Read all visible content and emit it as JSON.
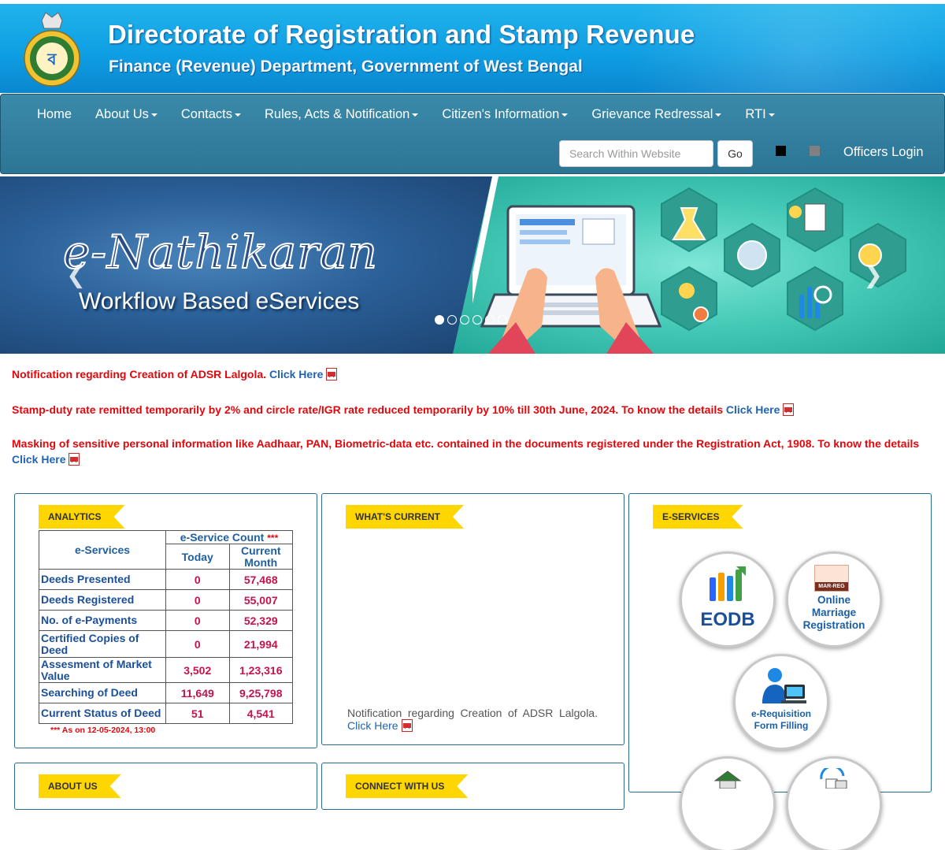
{
  "header": {
    "title": "Directorate of Registration and Stamp Revenue",
    "subtitle": "Finance (Revenue) Department, Government of West Bengal"
  },
  "nav": {
    "items": [
      "Home",
      "About Us",
      "Contacts",
      "Rules, Acts & Notification",
      "Citizen's Information",
      "Grievance Redressal",
      "RTI"
    ],
    "search_placeholder": "Search Within Website",
    "go_label": "Go",
    "officers_login": "Officers Login"
  },
  "banner": {
    "title": "e-Nathikaran",
    "subtitle": "Workflow Based eServices",
    "slide_count": 6,
    "active_slide": 1
  },
  "notices": [
    {
      "text": "Notification regarding Creation of ADSR Lalgola.",
      "link": "Click Here"
    },
    {
      "text": "Stamp-duty rate remitted temporarily by 2% and circle rate/IGR rate reduced temporarily by 10% till 30th June, 2024. To know the details",
      "link": "Click Here"
    },
    {
      "text": "Masking of sensitive personal information like Aadhaar, PAN, Biometric-data etc. contained in the documents registered under the Registration Act, 1908. To know the details",
      "link": "Click Here"
    }
  ],
  "analytics": {
    "ribbon": "ANALYTICS",
    "col_service": "e-Services",
    "col_count": "e-Service Count",
    "count_marker": "***",
    "col_today": "Today",
    "col_month": "Current Month",
    "rows": [
      {
        "service": "Deeds Presented",
        "today": "0",
        "month": "57,468"
      },
      {
        "service": "Deeds Registered",
        "today": "0",
        "month": "55,007"
      },
      {
        "service": "No. of e-Payments",
        "today": "0",
        "month": "52,329"
      },
      {
        "service": "Certified Copies of Deed",
        "today": "0",
        "month": "21,994"
      },
      {
        "service": "Assesment of Market Value",
        "today": "3,502",
        "month": "1,23,316"
      },
      {
        "service": "Searching of Deed",
        "today": "11,649",
        "month": "9,25,798"
      },
      {
        "service": "Current Status of Deed",
        "today": "51",
        "month": "4,541"
      }
    ],
    "as_of": "*** As on 12-05-2024, 13:00"
  },
  "whats_current": {
    "ribbon": "WHAT'S CURRENT",
    "text": "Notification regarding Creation of ADSR Lalgola.",
    "link": "Click Here"
  },
  "eservices": {
    "ribbon": "E-SERVICES",
    "eodb": "EODB",
    "marriage_tag": "MAR-REG",
    "marriage": [
      "Online",
      "Marriage",
      "Registration"
    ],
    "requisition": [
      "e-Requisition",
      "Form Filling"
    ]
  },
  "about": {
    "ribbon": "ABOUT US"
  },
  "connect": {
    "ribbon": "CONNECT WITH US"
  },
  "colors": {
    "header_blue": "#0f9fe3",
    "nav_teal": "#2c7595",
    "notice_red": "#e0080d",
    "link_blue": "#2164b4",
    "ribbon_yellow": "#ffd600",
    "value_magenta": "#c3134b"
  }
}
